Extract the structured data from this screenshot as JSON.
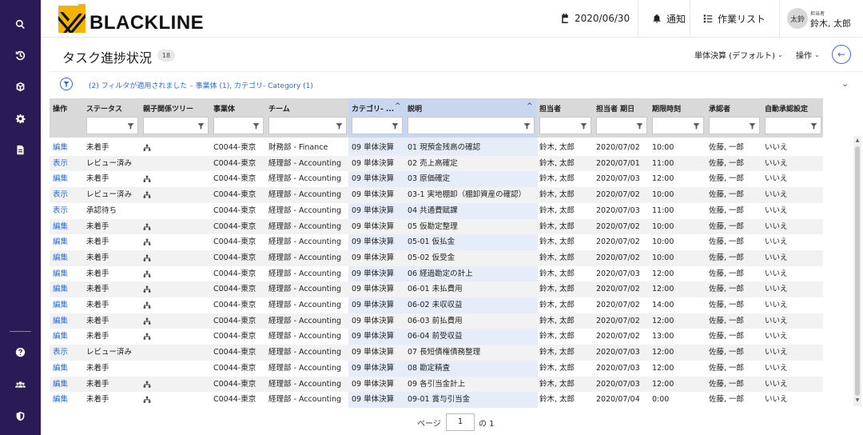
{
  "header": {
    "logo_text": "BLACKLINE",
    "date": "2020/06/30",
    "notifications_label": "通知",
    "worklist_label": "作業リスト",
    "avatar_initials": "太鈴",
    "user_role": "担当者",
    "user_name": "鈴木, 太郎"
  },
  "page": {
    "title": "タスク進捗状況",
    "count": "18",
    "view_dropdown": "単体決算 (デフォルト)",
    "actions_dropdown": "操作"
  },
  "filter": {
    "text": "(2) フィルタが適用されました – 事業体 (1), カテゴリ- Category (1)"
  },
  "table": {
    "columns": [
      "操作",
      "ステータス",
      "親子関係ツリー",
      "事業体",
      "チーム",
      "カテゴリ- ...",
      "説明",
      "担当者",
      "担当者 期日",
      "期限時刻",
      "承認者",
      "自動承認設定"
    ],
    "rows": [
      {
        "action": "編集",
        "status": "未着手",
        "tree": true,
        "entity": "C0044-東京",
        "team": "財務部 - Finance",
        "category": "09 単体決算",
        "desc": "01 現預金残高の確認",
        "assignee": "鈴木, 太郎",
        "due": "2020/07/02",
        "time": "10:00",
        "approver": "佐藤, 一郎",
        "auto": "いいえ"
      },
      {
        "action": "表示",
        "status": "レビュー済み",
        "tree": false,
        "entity": "C0044-東京",
        "team": "経理部 - Accounting",
        "category": "09 単体決算",
        "desc": "02 売上高確定",
        "assignee": "鈴木, 太郎",
        "due": "2020/07/01",
        "time": "11:00",
        "approver": "佐藤, 一郎",
        "auto": "いいえ"
      },
      {
        "action": "編集",
        "status": "未着手",
        "tree": true,
        "entity": "C0044-東京",
        "team": "経理部 - Accounting",
        "category": "09 単体決算",
        "desc": "03 原価確定",
        "assignee": "鈴木, 太郎",
        "due": "2020/07/03",
        "time": "12:00",
        "approver": "佐藤, 一郎",
        "auto": "いいえ"
      },
      {
        "action": "表示",
        "status": "レビュー済み",
        "tree": true,
        "entity": "C0044-東京",
        "team": "経理部 - Accounting",
        "category": "09 単体決算",
        "desc": "03-1 実地棚卸（棚卸資産の確認）",
        "assignee": "鈴木, 太郎",
        "due": "2020/07/02",
        "time": "10:00",
        "approver": "佐藤, 一郎",
        "auto": "いいえ"
      },
      {
        "action": "表示",
        "status": "承認待ち",
        "tree": false,
        "entity": "C0044-東京",
        "team": "経理部 - Accounting",
        "category": "09 単体決算",
        "desc": "04 共通費賦課",
        "assignee": "鈴木, 太郎",
        "due": "2020/07/03",
        "time": "11:00",
        "approver": "佐藤, 一郎",
        "auto": "いいえ"
      },
      {
        "action": "編集",
        "status": "未着手",
        "tree": true,
        "entity": "C0044-東京",
        "team": "経理部 - Accounting",
        "category": "09 単体決算",
        "desc": "05 仮勘定整理",
        "assignee": "鈴木, 太郎",
        "due": "2020/07/02",
        "time": "10:00",
        "approver": "佐藤, 一郎",
        "auto": "いいえ"
      },
      {
        "action": "編集",
        "status": "未着手",
        "tree": true,
        "entity": "C0044-東京",
        "team": "経理部 - Accounting",
        "category": "09 単体決算",
        "desc": "05-01 仮払金",
        "assignee": "鈴木, 太郎",
        "due": "2020/07/02",
        "time": "10:00",
        "approver": "佐藤, 一郎",
        "auto": "いいえ"
      },
      {
        "action": "編集",
        "status": "未着手",
        "tree": true,
        "entity": "C0044-東京",
        "team": "経理部 - Accounting",
        "category": "09 単体決算",
        "desc": "05-02 仮受金",
        "assignee": "鈴木, 太郎",
        "due": "2020/07/02",
        "time": "10:00",
        "approver": "佐藤, 一郎",
        "auto": "いいえ"
      },
      {
        "action": "編集",
        "status": "未着手",
        "tree": true,
        "entity": "C0044-東京",
        "team": "経理部 - Accounting",
        "category": "09 単体決算",
        "desc": "06 経過勘定の計上",
        "assignee": "鈴木, 太郎",
        "due": "2020/07/03",
        "time": "12:00",
        "approver": "佐藤, 一郎",
        "auto": "いいえ"
      },
      {
        "action": "編集",
        "status": "未着手",
        "tree": true,
        "entity": "C0044-東京",
        "team": "経理部 - Accounting",
        "category": "09 単体決算",
        "desc": "06-01 未払費用",
        "assignee": "鈴木, 太郎",
        "due": "2020/07/02",
        "time": "12:00",
        "approver": "佐藤, 一郎",
        "auto": "いいえ"
      },
      {
        "action": "編集",
        "status": "未着手",
        "tree": true,
        "entity": "C0044-東京",
        "team": "経理部 - Accounting",
        "category": "09 単体決算",
        "desc": "06-02 未収収益",
        "assignee": "鈴木, 太郎",
        "due": "2020/07/02",
        "time": "14:00",
        "approver": "佐藤, 一郎",
        "auto": "いいえ"
      },
      {
        "action": "編集",
        "status": "未着手",
        "tree": true,
        "entity": "C0044-東京",
        "team": "経理部 - Accounting",
        "category": "09 単体決算",
        "desc": "06-03 前払費用",
        "assignee": "鈴木, 太郎",
        "due": "2020/07/02",
        "time": "12:00",
        "approver": "佐藤, 一郎",
        "auto": "いいえ"
      },
      {
        "action": "編集",
        "status": "未着手",
        "tree": true,
        "entity": "C0044-東京",
        "team": "経理部 - Accounting",
        "category": "09 単体決算",
        "desc": "06-04 前受収益",
        "assignee": "鈴木, 太郎",
        "due": "2020/07/02",
        "time": "13:00",
        "approver": "佐藤, 一郎",
        "auto": "いいえ"
      },
      {
        "action": "表示",
        "status": "レビュー済み",
        "tree": false,
        "entity": "C0044-東京",
        "team": "経理部 - Accounting",
        "category": "09 単体決算",
        "desc": "07 長短債権債務整理",
        "assignee": "鈴木, 太郎",
        "due": "2020/07/03",
        "time": "12:00",
        "approver": "佐藤, 一郎",
        "auto": "いいえ"
      },
      {
        "action": "編集",
        "status": "未着手",
        "tree": false,
        "entity": "C0044-東京",
        "team": "経理部 - Accounting",
        "category": "09 単体決算",
        "desc": "08 勘定精査",
        "assignee": "鈴木, 太郎",
        "due": "2020/07/03",
        "time": "12:00",
        "approver": "佐藤, 一郎",
        "auto": "いいえ"
      },
      {
        "action": "編集",
        "status": "未着手",
        "tree": true,
        "entity": "C0044-東京",
        "team": "経理部 - Accounting",
        "category": "09 単体決算",
        "desc": "09 各引当金計上",
        "assignee": "鈴木, 太郎",
        "due": "2020/07/03",
        "time": "12:00",
        "approver": "佐藤, 一郎",
        "auto": "いいえ"
      },
      {
        "action": "編集",
        "status": "未着手",
        "tree": true,
        "entity": "C0044-東京",
        "team": "経理部 - Accounting",
        "category": "09 単体決算",
        "desc": "09-01 賞与引当金",
        "assignee": "鈴木, 太郎",
        "due": "2020/07/04",
        "time": "0:00",
        "approver": "佐藤, 一郎",
        "auto": "いいえ"
      }
    ]
  },
  "pager": {
    "label": "ページ",
    "current": "1",
    "of_label": "の 1"
  },
  "colors": {
    "rail": "#2a1a55",
    "link": "#2d6ccf",
    "logo_yellow": "#f2b400"
  }
}
